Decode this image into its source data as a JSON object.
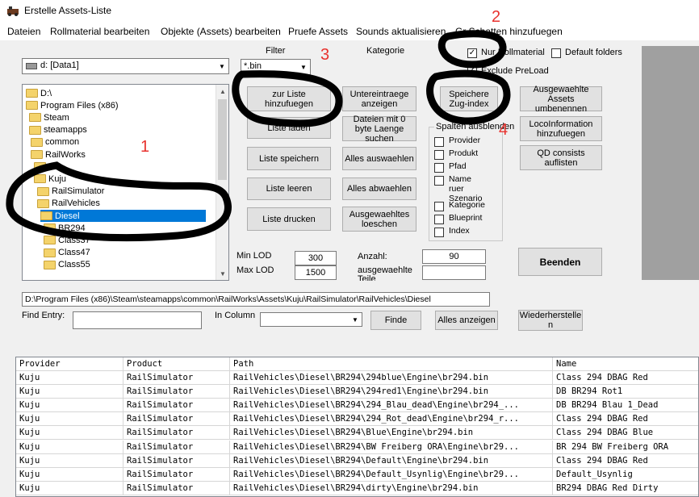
{
  "window": {
    "title": "Erstelle Assets-Liste",
    "icon": "app-icon"
  },
  "menu": [
    "Dateien",
    "Rollmaterial bearbeiten",
    "Objekte (Assets) bearbeiten",
    "Pruefe Assets",
    "Sounds aktualisieren",
    "Gr Schatten hinzufuegen"
  ],
  "drive": {
    "value": "d: [Data1]"
  },
  "filter": {
    "label": "Filter",
    "value": "*.bin"
  },
  "kategorie_label": "Kategorie",
  "checkboxes": {
    "nur_rollmaterial": {
      "label": "Nur Rollmaterial",
      "checked": true
    },
    "default_folders": {
      "label": "Default folders",
      "checked": false
    },
    "exclude_preload": {
      "label": "Exclude PreLoad",
      "checked": true
    }
  },
  "tree": {
    "items": [
      {
        "label": "D:\\",
        "level": 0
      },
      {
        "label": "Program Files (x86)",
        "level": 0
      },
      {
        "label": "Steam",
        "level": 1
      },
      {
        "label": "steamapps",
        "level": 1
      },
      {
        "label": "common",
        "level": 2
      },
      {
        "label": "RailWorks",
        "level": 2
      },
      {
        "label": "A",
        "level": 3
      },
      {
        "label": "Kuju",
        "level": 3
      },
      {
        "label": "RailSimulator",
        "level": 4
      },
      {
        "label": "RailVehicles",
        "level": 4
      },
      {
        "label": "Diesel",
        "level": 5,
        "selected": true
      },
      {
        "label": "BR294",
        "level": 6
      },
      {
        "label": "Class37",
        "level": 6
      },
      {
        "label": "Class47",
        "level": 6
      },
      {
        "label": "Class55",
        "level": 6
      }
    ]
  },
  "buttons": {
    "zur_liste": "zur Liste hinzufuegen",
    "liste_laden": "Liste laden",
    "liste_speichern": "Liste speichern",
    "liste_leeren": "Liste leeren",
    "liste_drucken": "Liste drucken",
    "untereintraege": "Untereintraege anzeigen",
    "dateien_0byte": "Dateien mit 0 byte Laenge suchen",
    "alles_auswaehlen": "Alles auswaehlen",
    "alles_abwaehlen": "Alles abwaehlen",
    "ausgewaehltes_loeschen": "Ausgewaehltes loeschen",
    "speichere_zugindex": "Speichere Zug-index",
    "assets_umbenennen": "Ausgewaehlte Assets umbenennen",
    "locoinformation": "LocoInformation hinzufuegen",
    "qd_consists": "QD consists auflisten",
    "beenden": "Beenden",
    "finde": "Finde",
    "alles_anzeigen": "Alles anzeigen",
    "wiederherstellen": "Wiederherstelle n"
  },
  "spalten": {
    "title": "Spalten ausblenden",
    "items": [
      "Provider",
      "Produkt",
      "Pfad",
      "Name",
      "ruer",
      "Szenario",
      "Kategorie",
      "Blueprint",
      "Index"
    ]
  },
  "lod": {
    "min_label": "Min LOD",
    "min_value": "300",
    "max_label": "Max LOD",
    "max_value": "1500"
  },
  "anzahl": {
    "label": "Anzahl:",
    "value": "90",
    "selected_label": "ausgewaehlte Teile",
    "selected_value": ""
  },
  "path_value": "D:\\Program Files (x86)\\Steam\\steamapps\\common\\RailWorks\\Assets\\Kuju\\RailSimulator\\RailVehicles\\Diesel",
  "find": {
    "label": "Find Entry:",
    "value": "",
    "column_label": "In Column",
    "column_value": ""
  },
  "grid": {
    "headers": [
      "Provider",
      "Product",
      "Path",
      "Name"
    ],
    "rows": [
      [
        "Kuju",
        "RailSimulator",
        "RailVehicles\\Diesel\\BR294\\294blue\\Engine\\br294.bin",
        "Class 294 DBAG Red"
      ],
      [
        "Kuju",
        "RailSimulator",
        "RailVehicles\\Diesel\\BR294\\294red1\\Engine\\br294.bin",
        "DB BR294 Rot1"
      ],
      [
        "Kuju",
        "RailSimulator",
        "RailVehicles\\Diesel\\BR294\\294_Blau_dead\\Engine\\br294_...",
        "DB BR294 Blau 1_Dead"
      ],
      [
        "Kuju",
        "RailSimulator",
        "RailVehicles\\Diesel\\BR294\\294_Rot_dead\\Engine\\br294_r...",
        "Class 294 DBAG Red"
      ],
      [
        "Kuju",
        "RailSimulator",
        "RailVehicles\\Diesel\\BR294\\Blue\\Engine\\br294.bin",
        "Class 294 DBAG Blue"
      ],
      [
        "Kuju",
        "RailSimulator",
        "RailVehicles\\Diesel\\BR294\\BW Freiberg ORA\\Engine\\br29...",
        "BR 294 BW Freiberg ORA"
      ],
      [
        "Kuju",
        "RailSimulator",
        "RailVehicles\\Diesel\\BR294\\Default\\Engine\\br294.bin",
        "Class 294 DBAG Red"
      ],
      [
        "Kuju",
        "RailSimulator",
        "RailVehicles\\Diesel\\BR294\\Default_Usynlig\\Engine\\br29...",
        "Default_Usynlig"
      ],
      [
        "Kuju",
        "RailSimulator",
        "RailVehicles\\Diesel\\BR294\\dirty\\Engine\\br294.bin",
        "BR294 DBAG Red Dirty"
      ]
    ]
  },
  "annotations": [
    "1",
    "2",
    "3",
    "4"
  ],
  "colors": {
    "selection": "#0078d7",
    "annotation": "#e8322e"
  }
}
